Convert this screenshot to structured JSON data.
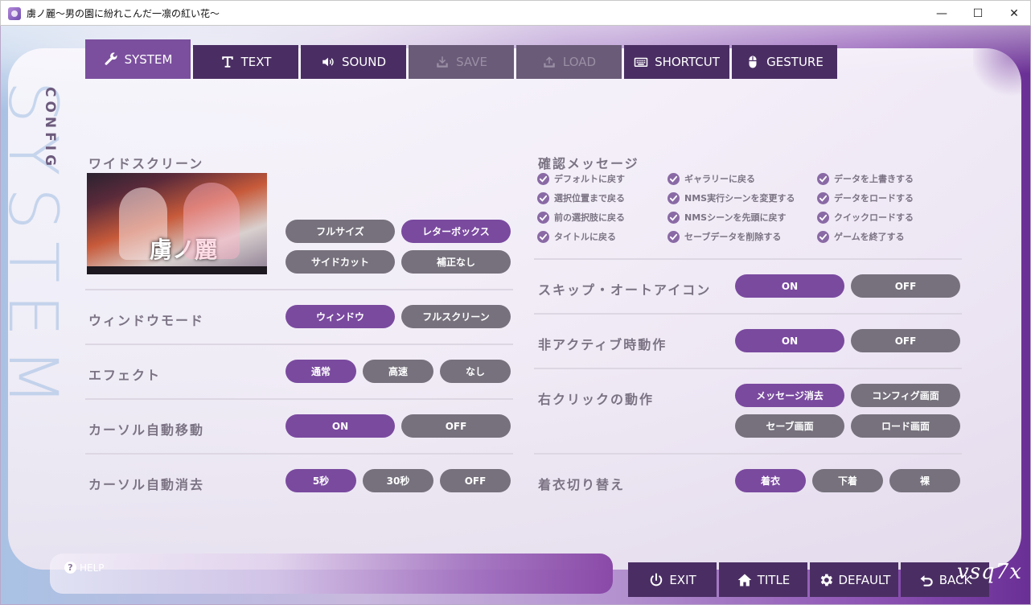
{
  "window": {
    "title": "虜ノ麗～男の園に紛れこんだ一凛の紅い花～",
    "minimize": "—",
    "maximize": "☐",
    "close": "✕"
  },
  "colors": {
    "accent": "#7a4a9f",
    "tab": "#4a2e63",
    "pill_off": "#76717c"
  },
  "side": {
    "config": "CONFIG",
    "system": "SYSTEM"
  },
  "tabs": [
    {
      "label": "SYSTEM",
      "icon": "wrench-icon",
      "state": "active"
    },
    {
      "label": "TEXT",
      "icon": "text-t-icon",
      "state": "normal"
    },
    {
      "label": "SOUND",
      "icon": "speaker-icon",
      "state": "normal"
    },
    {
      "label": "SAVE",
      "icon": "save-tray-icon",
      "state": "disabled"
    },
    {
      "label": "LOAD",
      "icon": "load-tray-icon",
      "state": "disabled"
    },
    {
      "label": "SHORTCUT",
      "icon": "keyboard-icon",
      "state": "normal"
    },
    {
      "label": "GESTURE",
      "icon": "mouse-icon",
      "state": "normal"
    }
  ],
  "left": {
    "widescreen": {
      "label": "ワイドスクリーン",
      "preview_logo": "虜ノ麗",
      "options": [
        "フルサイズ",
        "レターボックス",
        "サイドカット",
        "補正なし"
      ],
      "selected": "レターボックス"
    },
    "window_mode": {
      "label": "ウィンドウモード",
      "options": [
        "ウィンドウ",
        "フルスクリーン"
      ],
      "selected": "ウィンドウ"
    },
    "effect": {
      "label": "エフェクト",
      "options": [
        "通常",
        "高速",
        "なし"
      ],
      "selected": "通常"
    },
    "cursor_move": {
      "label": "カーソル自動移動",
      "options": [
        "ON",
        "OFF"
      ],
      "selected": "ON"
    },
    "cursor_hide": {
      "label": "カーソル自動消去",
      "options": [
        "5秒",
        "30秒",
        "OFF"
      ],
      "selected": "5秒"
    }
  },
  "right": {
    "confirm": {
      "label": "確認メッセージ",
      "items": [
        "デフォルトに戻す",
        "ギャラリーに戻る",
        "データを上書きする",
        "選択位置まで戻る",
        "NMS実行シーンを変更する",
        "データをロードする",
        "前の選択肢に戻る",
        "NMSシーンを先頭に戻す",
        "クイックロードする",
        "タイトルに戻る",
        "セーブデータを削除する",
        "ゲームを終了する"
      ]
    },
    "skip_icon": {
      "label": "スキップ・オートアイコン",
      "options": [
        "ON",
        "OFF"
      ],
      "selected": "ON"
    },
    "inactive": {
      "label": "非アクティブ時動作",
      "options": [
        "ON",
        "OFF"
      ],
      "selected": "ON"
    },
    "right_click": {
      "label": "右クリックの動作",
      "options": [
        "メッセージ消去",
        "コンフィグ画面",
        "セーブ画面",
        "ロード画面"
      ],
      "selected": "メッセージ消去"
    },
    "outfit": {
      "label": "着衣切り替え",
      "options": [
        "着衣",
        "下着",
        "裸"
      ],
      "selected": "着衣"
    }
  },
  "bottom": {
    "help": "HELP",
    "help_icon": "?",
    "buttons": [
      {
        "label": "EXIT",
        "icon": "power-icon"
      },
      {
        "label": "TITLE",
        "icon": "house-icon"
      },
      {
        "label": "DEFAULT",
        "icon": "gear-icon"
      },
      {
        "label": "BACK",
        "icon": "back-arrow-icon"
      }
    ],
    "signature": "vsq7x"
  }
}
